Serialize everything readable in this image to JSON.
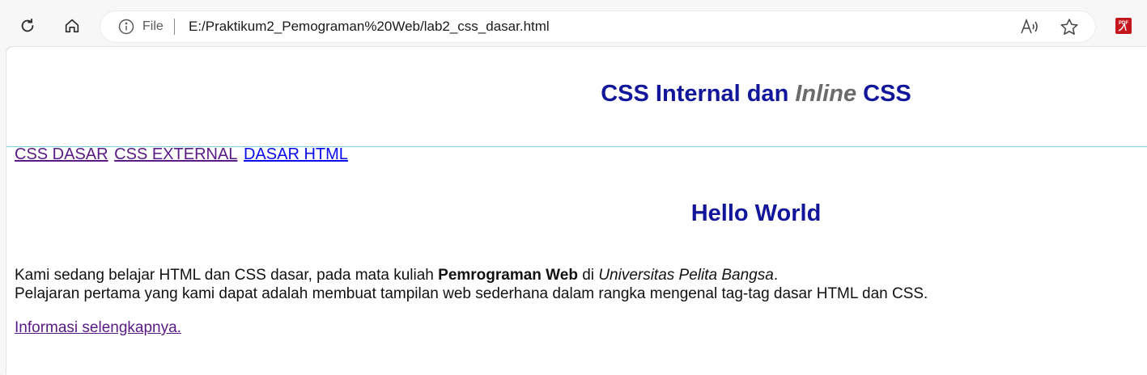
{
  "browser": {
    "address_bar": {
      "scheme_label": "File",
      "url": "E:/Praktikum2_Pemograman%20Web/lab2_css_dasar.html"
    },
    "icons": [
      "reload-icon",
      "home-icon",
      "info-icon",
      "read-aloud-icon",
      "favorite-star-icon",
      "pdf-extension-icon"
    ]
  },
  "page": {
    "header": {
      "title_part1": "CSS Internal dan ",
      "title_italic": "Inline",
      "title_part2": " CSS"
    },
    "nav": [
      {
        "label": "CSS DASAR",
        "state": "visited"
      },
      {
        "label": "CSS EXTERNAL",
        "state": "visited"
      },
      {
        "label": "DASAR HTML",
        "state": "unvisited"
      }
    ],
    "heading": "Hello World",
    "paragraph": {
      "line1_text": "Kami sedang belajar HTML dan CSS dasar, pada mata kuliah ",
      "line1_bold": "Pemrograman Web",
      "line1_mid": " di ",
      "line1_italic": "Universitas Pelita Bangsa",
      "line1_end": ".",
      "line2": "Pelajaran pertama yang kami dapat adalah membuat tampilan web sederhana dalam rangka mengenal tag-tag dasar HTML dan CSS."
    },
    "more_link": "Informasi selengkapnya."
  },
  "colors": {
    "heading": "#12169a",
    "italic_gray": "#6b6b6b",
    "visited_link": "#5a1a86",
    "link": "#0a0aee",
    "rule": "#87cde0"
  }
}
